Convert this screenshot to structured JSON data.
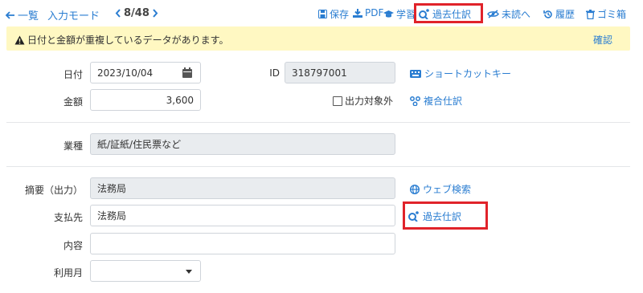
{
  "toolbar": {
    "back_label": "一覧",
    "mode_label": "入力モード",
    "pager": "8/48",
    "save_label": "保存",
    "pdf_label": "PDF",
    "learn_label": "学習",
    "past_entries_label": "過去仕訳",
    "unread_label": "未読へ",
    "history_label": "履歴",
    "trash_label": "ゴミ箱"
  },
  "warning": {
    "text": "日付と金額が重複しているデータがあります。",
    "confirm_label": "確認"
  },
  "form": {
    "date_label": "日付",
    "date_value": "2023/10/04",
    "id_label": "ID",
    "id_value": "318797001",
    "shortcut_label": "ショートカットキー",
    "amount_label": "金額",
    "amount_value": "3,600",
    "exclude_label": "出力対象外",
    "compound_label": "複合仕訳",
    "industry_label": "業種",
    "industry_value": "紙/証紙/住民票など",
    "summary_label": "摘要（出力）",
    "summary_value": "法務局",
    "web_search_label": "ウェブ検索",
    "payee_label": "支払先",
    "payee_value": "法務局",
    "past_entries_label": "過去仕訳",
    "content_label": "内容",
    "content_value": "",
    "month_label": "利用月",
    "month_value": ""
  },
  "colors": {
    "accent": "#2a7dd1",
    "warning_bg": "#fff8c2",
    "highlight": "#e0232a"
  }
}
